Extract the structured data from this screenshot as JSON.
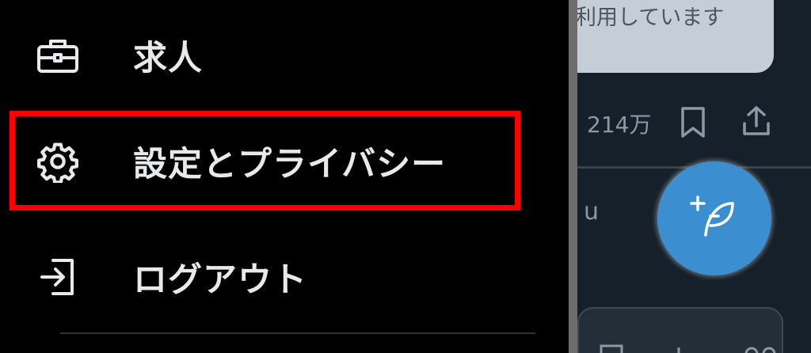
{
  "drawer": {
    "items": [
      {
        "label": "求人",
        "icon": "briefcase-icon"
      },
      {
        "label": "設定とプライバシー",
        "icon": "gear-icon"
      },
      {
        "label": "ログアウト",
        "icon": "logout-icon"
      }
    ]
  },
  "background": {
    "card_text": "利用しています",
    "view_count": "214万",
    "partial_text": "u"
  },
  "colors": {
    "highlight": "#ff0000",
    "fab": "#3b8fd0",
    "drawer_bg": "#000000",
    "timeline_bg": "#15202b"
  }
}
